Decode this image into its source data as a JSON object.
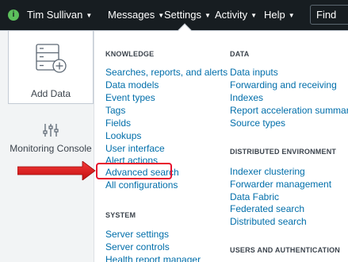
{
  "topbar": {
    "user_badge": "i",
    "user": "Tim Sullivan",
    "messages": "Messages",
    "settings": "Settings",
    "activity": "Activity",
    "help": "Help",
    "find_placeholder": "Find"
  },
  "tiles": {
    "add_data": "Add Data",
    "monitoring_console": "Monitoring Console"
  },
  "knowledge": {
    "title": "KNOWLEDGE",
    "items": [
      "Searches, reports, and alerts",
      "Data models",
      "Event types",
      "Tags",
      "Fields",
      "Lookups",
      "User interface",
      "Alert actions",
      "Advanced search",
      "All configurations"
    ]
  },
  "system": {
    "title": "SYSTEM",
    "items": [
      "Server settings",
      "Server controls",
      "Health report manager"
    ]
  },
  "data": {
    "title": "DATA",
    "items": [
      "Data inputs",
      "Forwarding and receiving",
      "Indexes",
      "Report acceleration summaries",
      "Source types"
    ]
  },
  "distributed": {
    "title": "DISTRIBUTED ENVIRONMENT",
    "items": [
      "Indexer clustering",
      "Forwarder management",
      "Data Fabric",
      "Federated search",
      "Distributed search"
    ]
  },
  "users": {
    "title": "USERS AND AUTHENTICATION"
  },
  "colors": {
    "topbar_bg": "#171d21",
    "link": "#006eaa",
    "highlight": "#e8112d"
  }
}
